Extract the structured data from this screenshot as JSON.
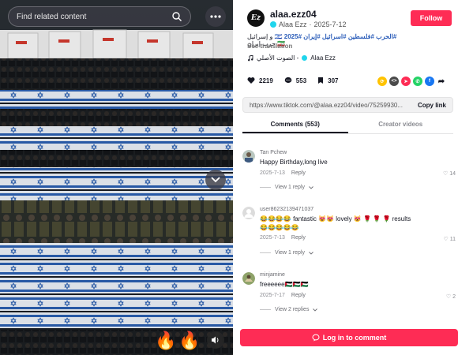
{
  "video": {
    "search_placeholder": "Find related content",
    "fire_emoji": "🔥"
  },
  "post": {
    "username": "alaa.ezz04",
    "display_name": "Alaa Ezz",
    "date": "2025-7-12",
    "follow_label": "Follow",
    "caption_tags": "#الحرب #فلسطين #اسرائيل #إيران #2025",
    "caption_text": "🇮🇱 و إسرائيل 🇮🇷 حرب إيران",
    "see_translation": "See translation",
    "music": "الصوت الأصلي - ",
    "music_author": "Alaa Ezz",
    "likes": "2219",
    "comments_count": "553",
    "saves": "307",
    "link_url": "https://www.tiktok.com/@alaa.ezz04/video/75259930...",
    "copy_link": "Copy link"
  },
  "tabs": {
    "comments": "Comments (553)",
    "creator_videos": "Creator videos"
  },
  "comments": [
    {
      "user": "Tan Pchew",
      "text": "Happy Birthday,long live",
      "date": "2025-7-13",
      "reply": "Reply",
      "likes": "14",
      "view": "View 1 reply"
    },
    {
      "user": "user86232139471037",
      "text": "😂😂😂😂 fantastic 😻😻 lovely 😻 🌹 🌹 🌹 results",
      "text2": "😂😂😂😂😂",
      "date": "2025-7-13",
      "reply": "Reply",
      "likes": "11",
      "view": "View 1 reply"
    },
    {
      "user": "minjamine",
      "text": "freeeeee🇵🇸🇵🇸🇵🇸",
      "date": "2025-7-17",
      "reply": "Reply",
      "likes": "2",
      "view": "View 2 replies"
    }
  ],
  "login_label": "Log in to comment",
  "colors": {
    "accent": "#fe2c55",
    "verified": "#20d5ec"
  }
}
